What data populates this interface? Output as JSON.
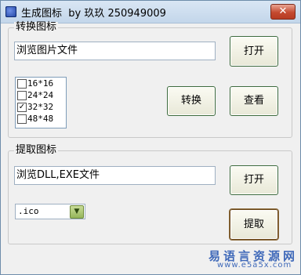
{
  "window": {
    "title": "生成图标  by 玖玖 250949009",
    "close_label": "✕"
  },
  "convert": {
    "group_label": "转换图标",
    "path_value": "浏览图片文件",
    "open_label": "打开",
    "sizes": [
      {
        "label": "16*16",
        "checked": false
      },
      {
        "label": "24*24",
        "checked": false
      },
      {
        "label": "32*32",
        "checked": true
      },
      {
        "label": "48*48",
        "checked": false
      }
    ],
    "convert_label": "转换",
    "view_label": "查看"
  },
  "extract": {
    "group_label": "提取图标",
    "path_value": "浏览DLL,EXE文件",
    "open_label": "打开",
    "format_value": ".ico",
    "extract_label": "提取"
  },
  "watermark": {
    "main": "易语言资源网",
    "url": "www.e5a5x.com"
  },
  "colors": {
    "button_border": "#3d6b3d",
    "watermark": "#3f69b9",
    "close_button": "#c44a30"
  }
}
